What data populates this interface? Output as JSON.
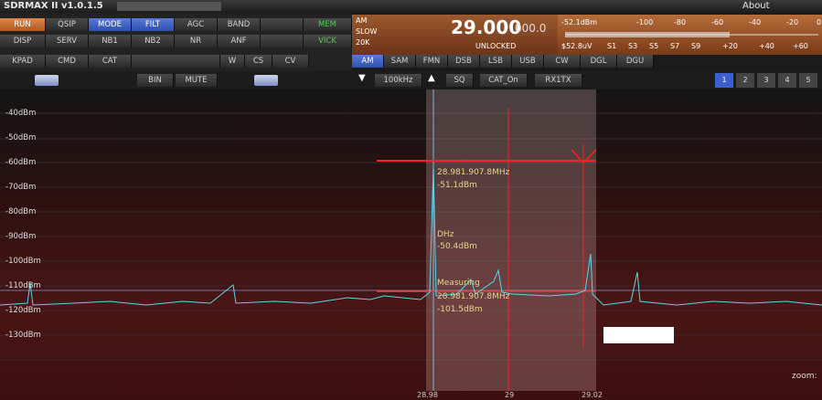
{
  "window": {
    "title": "SDRMAX II v1.0.1.5",
    "about": "About"
  },
  "toolbar": {
    "row1": [
      "RUN",
      "QSIP",
      "MODE",
      "FILT",
      "AGC",
      "BAND",
      "",
      "MEM"
    ],
    "row2": [
      "DISP",
      "SERV",
      "NB1",
      "NB2",
      "NR",
      "ANF",
      "",
      "VICK"
    ],
    "row3": [
      "KPAD",
      "CMD",
      "CAT",
      "",
      "W",
      "CS",
      "CV"
    ]
  },
  "freq": {
    "mode": "AM",
    "agc": "SLOW",
    "bw": "20K",
    "main": "29.000",
    "sub": "000.0",
    "status": "UNLOCKED"
  },
  "smeter": {
    "dbm": "-52.1dBm",
    "uv": "$52.8uV",
    "top_scale": [
      "-100",
      "-80",
      "-60",
      "-40",
      "-20",
      "0"
    ],
    "bottom_scale": [
      "S1",
      "S3",
      "S5",
      "S7",
      "S9",
      "+20",
      "+40",
      "+60"
    ]
  },
  "modes": [
    "AM",
    "SAM",
    "FMN",
    "DSB",
    "LSB",
    "USB",
    "CW",
    "DGL",
    "DGU"
  ],
  "controls": {
    "bin": "BIN",
    "mute": "MUTE",
    "step": "100kHz",
    "sq": "SQ",
    "cat": "CAT_On",
    "rxtx": "RX1TX"
  },
  "page_tabs": [
    "1",
    "2",
    "3",
    "4",
    "5"
  ],
  "spectrum": {
    "db_labels": [
      "-40dBm",
      "-50dBm",
      "-60dBm",
      "-70dBm",
      "-80dBm",
      "-90dBm",
      "-100dBm",
      "-110dBm",
      "-120dBm",
      "-130dBm"
    ],
    "marker1": {
      "freq": "28.981.907.8MHz",
      "level": "-51.1dBm"
    },
    "marker2": {
      "freq": "DHz",
      "level": "-50.4dBm"
    },
    "marker3": {
      "label": "Measuring",
      "freq": "28.981.907.8MHz",
      "level": "-101.5dBm"
    },
    "zoom": "zoom:",
    "freq_axis": [
      "28.98",
      "29",
      "29.02"
    ]
  },
  "colors": {
    "trace": "#5ad6e8",
    "cursor": "#ff2020",
    "filter_band": "#c8a4a4"
  }
}
